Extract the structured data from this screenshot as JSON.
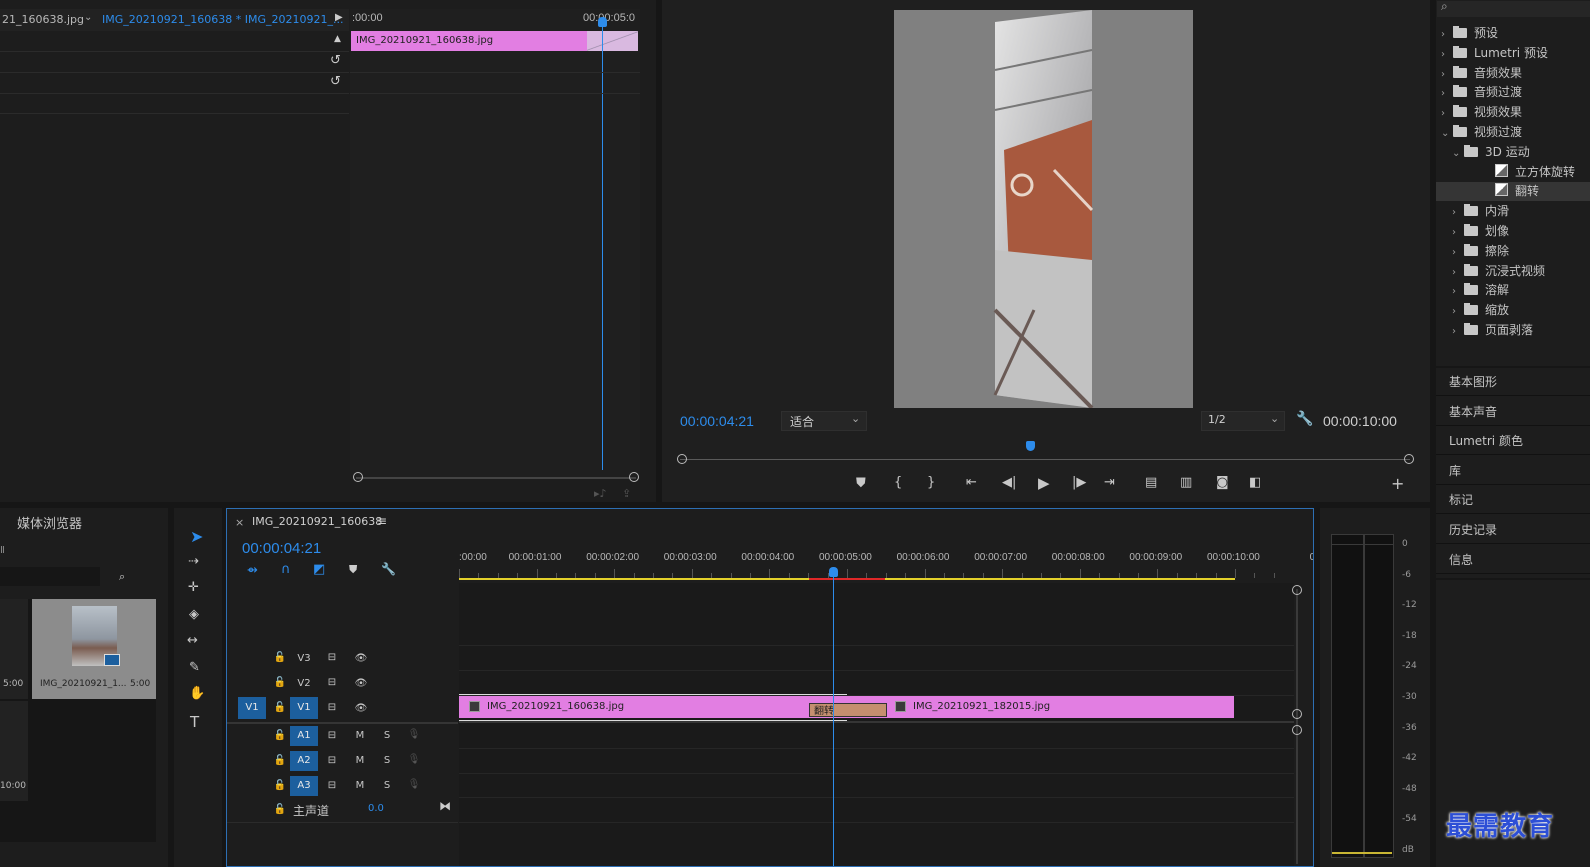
{
  "source_monitor": {
    "tab_left": "21_160638.jpg",
    "tab_sequence": "IMG_20210921_160638 * IMG_20210921_...",
    "ruler_start": ":00:00",
    "ruler_end": "00:00:05:0",
    "clip_name": "IMG_20210921_160638.jpg"
  },
  "program_monitor": {
    "current_time": "00:00:04:21",
    "fit_option": "适合",
    "resolution": "1/2",
    "duration": "00:00:10:00"
  },
  "effects_panel": {
    "search_placeholder": "",
    "items": [
      {
        "label": "预设",
        "level": 0,
        "expanded": false
      },
      {
        "label": "Lumetri 预设",
        "level": 0,
        "expanded": false
      },
      {
        "label": "音频效果",
        "level": 0,
        "expanded": false
      },
      {
        "label": "音频过渡",
        "level": 0,
        "expanded": false
      },
      {
        "label": "视频效果",
        "level": 0,
        "expanded": false
      },
      {
        "label": "视频过渡",
        "level": 0,
        "expanded": true
      },
      {
        "label": "3D 运动",
        "level": 1,
        "expanded": true
      },
      {
        "label": "立方体旋转",
        "level": 2,
        "expanded": null
      },
      {
        "label": "翻转",
        "level": 2,
        "expanded": null,
        "selected": true
      },
      {
        "label": "内滑",
        "level": 1,
        "expanded": false
      },
      {
        "label": "划像",
        "level": 1,
        "expanded": false
      },
      {
        "label": "擦除",
        "level": 1,
        "expanded": false
      },
      {
        "label": "沉浸式视频",
        "level": 1,
        "expanded": false
      },
      {
        "label": "溶解",
        "level": 1,
        "expanded": false
      },
      {
        "label": "缩放",
        "level": 1,
        "expanded": false
      },
      {
        "label": "页面剥落",
        "level": 1,
        "expanded": false
      }
    ]
  },
  "side_panels": [
    "基本图形",
    "基本声音",
    "Lumetri 颜色",
    "库",
    "标记",
    "历史记录",
    "信息"
  ],
  "project_panel": {
    "tab": "媒体浏览器",
    "label_small": "Ⅱ",
    "item_name": "IMG_20210921_1...",
    "item_duration": "5:00",
    "left_duration": "5:00",
    "left_time": "10:00"
  },
  "timeline": {
    "sequence_name": "IMG_20210921_160638",
    "current_time": "00:00:04:21",
    "ruler_labels": [
      ":00:00",
      "00:00:01:00",
      "00:00:02:00",
      "00:00:03:00",
      "00:00:04:00",
      "00:00:05:00",
      "00:00:06:00",
      "00:00:07:00",
      "00:00:08:00",
      "00:00:09:00",
      "00:00:10:00",
      "0"
    ],
    "video_tracks": [
      "V3",
      "V2",
      "V1"
    ],
    "source_patch": "V1",
    "audio_tracks": [
      "A1",
      "A2",
      "A3"
    ],
    "mute_label": "M",
    "solo_label": "S",
    "master_label": "主声道",
    "master_value": "0.0",
    "clip1": "IMG_20210921_160638.jpg",
    "clip2": "IMG_20210921_182015.jpg",
    "transition": "翻转"
  },
  "audio_meter": {
    "labels": [
      "0",
      "-6",
      "-12",
      "-18",
      "-24",
      "-30",
      "-36",
      "-42",
      "-48",
      "-54",
      "dB"
    ]
  },
  "watermark": "最需教育",
  "colors": {
    "accent_blue": "#2d8ceb",
    "clip_pink": "#e27ee2",
    "track_blue": "#1c5f9e"
  }
}
